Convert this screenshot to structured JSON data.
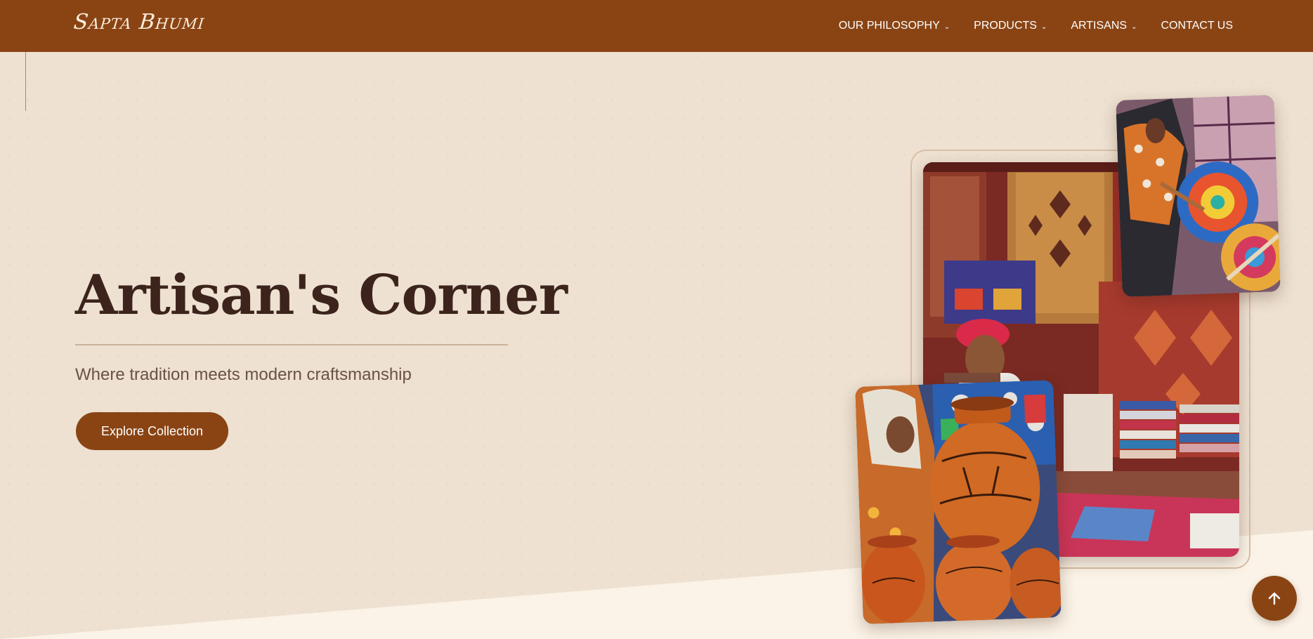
{
  "brand": {
    "logo_text": "Sapta Bhumi"
  },
  "nav": {
    "items": [
      {
        "label": "OUR PHILOSOPHY",
        "has_dropdown": true
      },
      {
        "label": "PRODUCTS",
        "has_dropdown": true
      },
      {
        "label": "ARTISANS",
        "has_dropdown": true
      },
      {
        "label": "CONTACT US",
        "has_dropdown": false
      }
    ],
    "dropdown_icon": "chevron-down-icon"
  },
  "hero": {
    "title": "Artisan's Corner",
    "subtitle": "Where tradition meets modern craftsmanship",
    "cta_label": "Explore Collection"
  },
  "gallery": {
    "images": [
      {
        "subject": "artisan-with-textiles"
      },
      {
        "subject": "woman-painting-fans"
      },
      {
        "subject": "woman-painting-pottery"
      }
    ]
  },
  "scroll_top": {
    "icon": "arrow-up-icon"
  },
  "colors": {
    "brand_brown": "#8a4414",
    "background": "#eee1d1",
    "title_text": "#3c241c",
    "subtitle_text": "#6a5245",
    "bottom_band": "#fbf3e7"
  }
}
